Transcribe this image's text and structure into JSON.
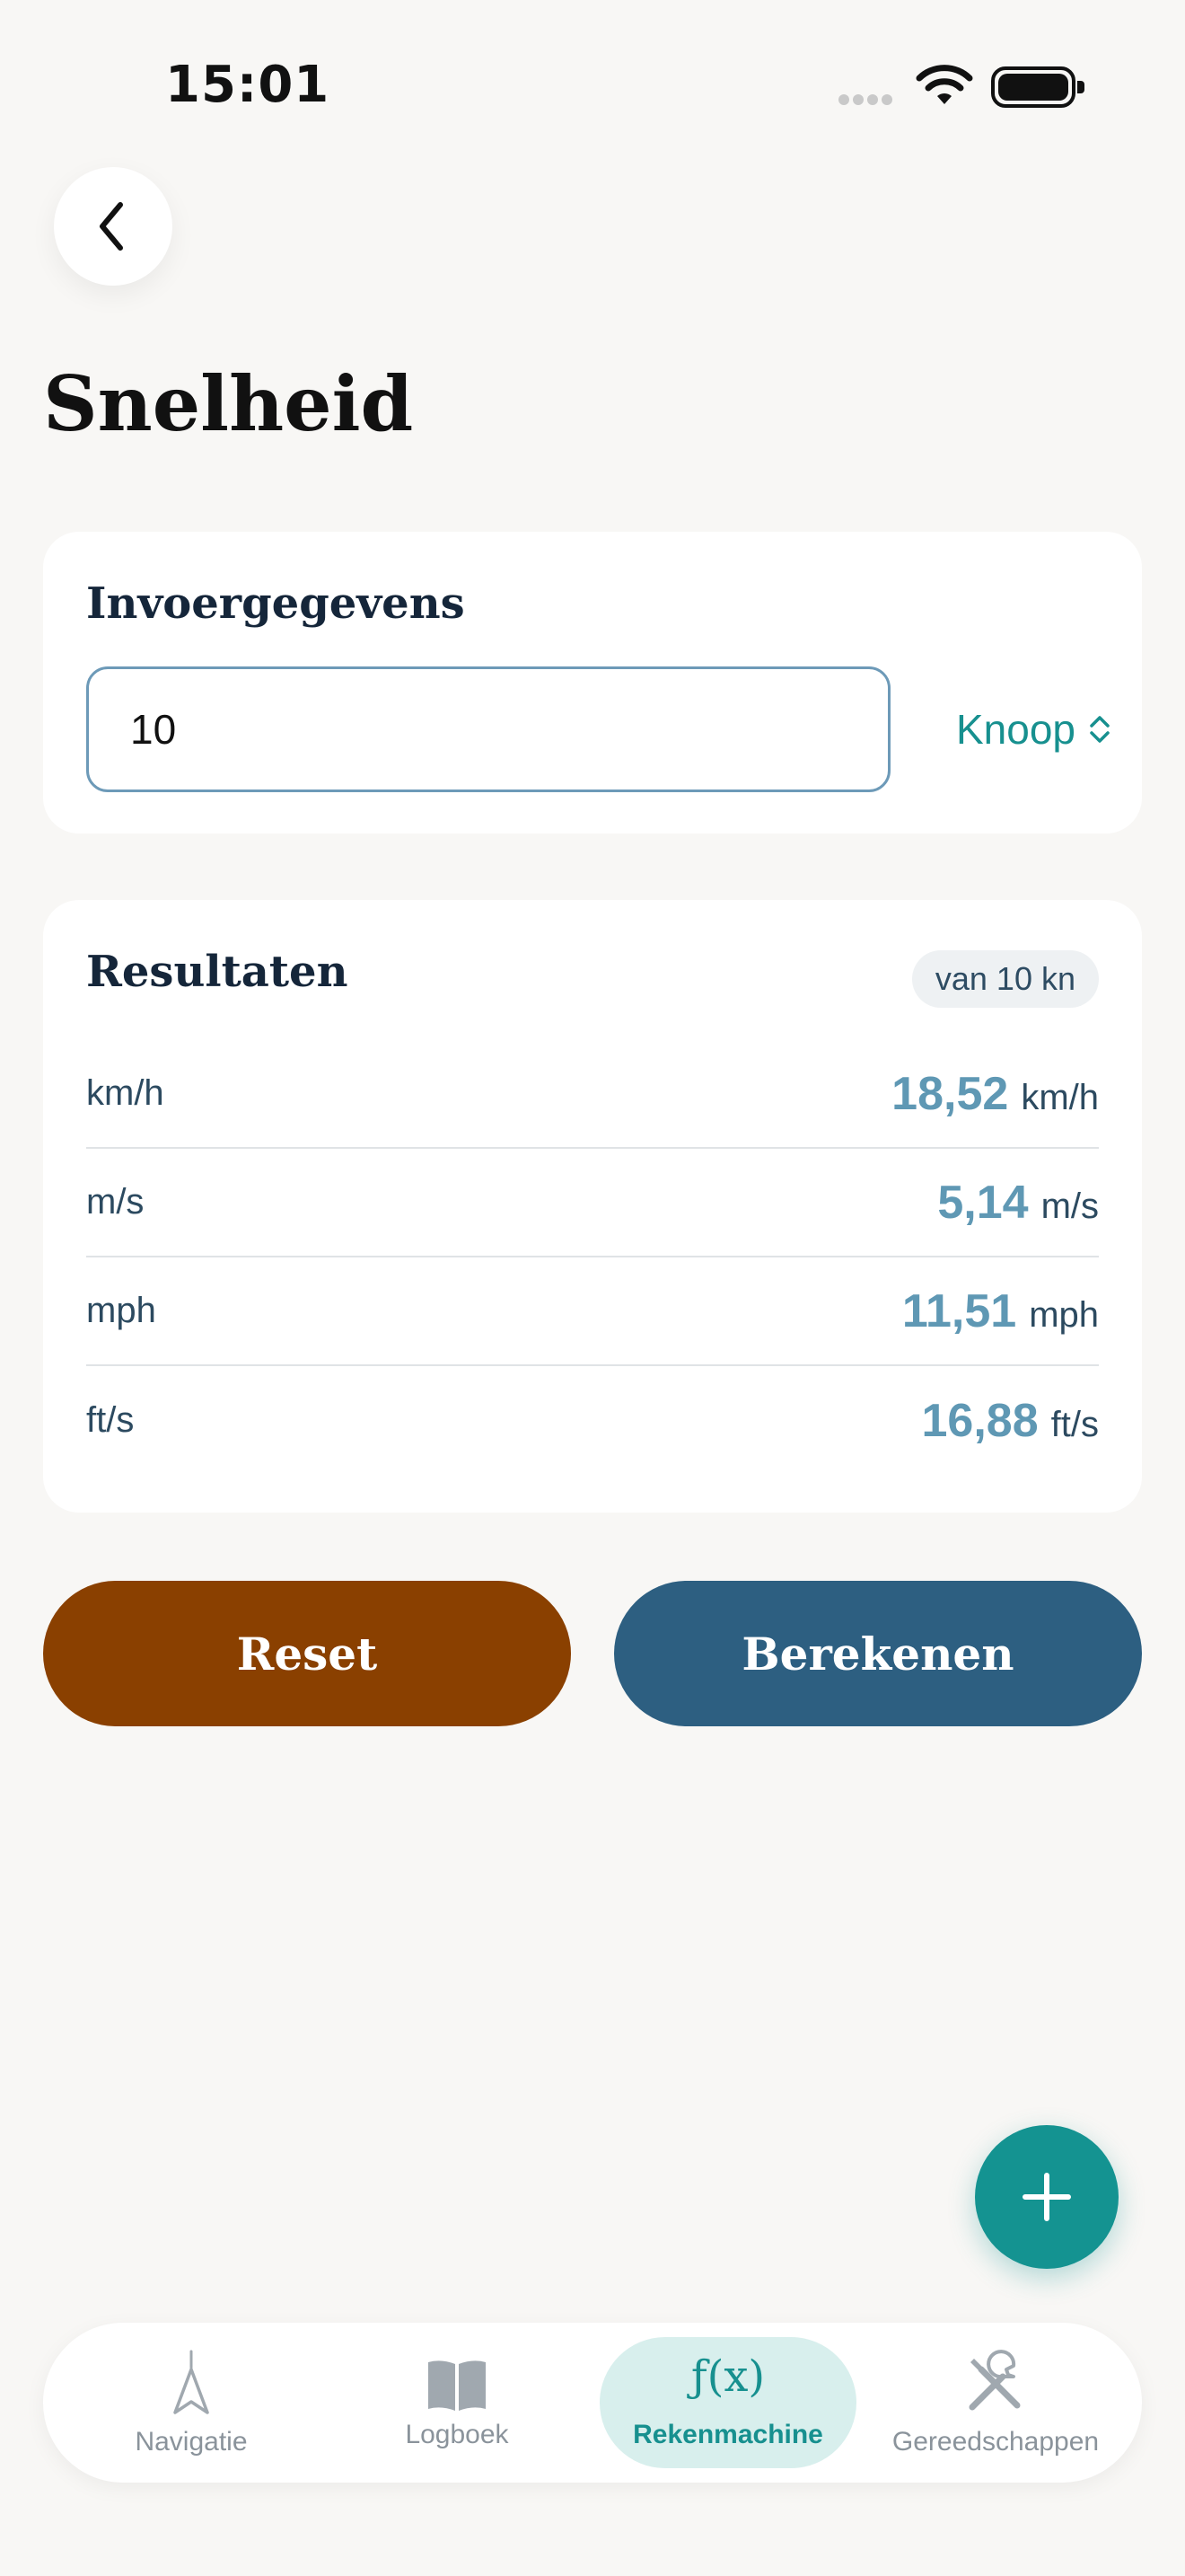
{
  "status_bar": {
    "time": "15:01"
  },
  "header": {
    "title": "Snelheid"
  },
  "input_card": {
    "title": "Invoergegevens",
    "value": "10",
    "unit": "Knoop"
  },
  "results_card": {
    "title": "Resultaten",
    "badge": "van 10 kn",
    "rows": [
      {
        "label": "km/h",
        "value": "18,52",
        "unit": "km/h"
      },
      {
        "label": "m/s",
        "value": "5,14",
        "unit": "m/s"
      },
      {
        "label": "mph",
        "value": "11,51",
        "unit": "mph"
      },
      {
        "label": "ft/s",
        "value": "16,88",
        "unit": "ft/s"
      }
    ]
  },
  "actions": {
    "reset_label": "Reset",
    "calculate_label": "Berekenen"
  },
  "tab_bar": {
    "active": "Rekenmachine",
    "tabs": [
      {
        "label": "Navigatie",
        "icon": "compass-icon"
      },
      {
        "label": "Logboek",
        "icon": "book-icon"
      },
      {
        "label": "Rekenmachine",
        "icon": "function-icon",
        "icon_text": "ƒ(x)"
      },
      {
        "label": "Gereedschappen",
        "icon": "tools-icon"
      }
    ]
  },
  "colors": {
    "accent": "#17908f",
    "reset": "#8a4000",
    "calculate": "#2d5f81",
    "result_value": "#5f98b4"
  }
}
